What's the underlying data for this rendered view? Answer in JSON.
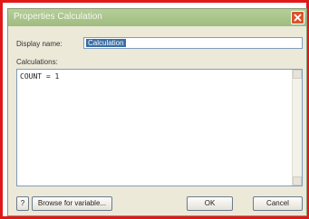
{
  "dialog": {
    "title": "Properties Calculation",
    "display_name_label": "Display name:",
    "display_name_value": "Calculation",
    "calculations_label": "Calculations:",
    "calculations_value": "COUNT = 1"
  },
  "buttons": {
    "help": "?",
    "browse": "Browse for variable...",
    "ok": "OK",
    "cancel": "Cancel"
  },
  "colors": {
    "frame_border": "#e01818",
    "titlebar": "#a9c58c",
    "close_button": "#d9542e",
    "dialog_background": "#ece9d8",
    "selection": "#3a6ea5"
  },
  "icons": {
    "close": "close-icon"
  }
}
